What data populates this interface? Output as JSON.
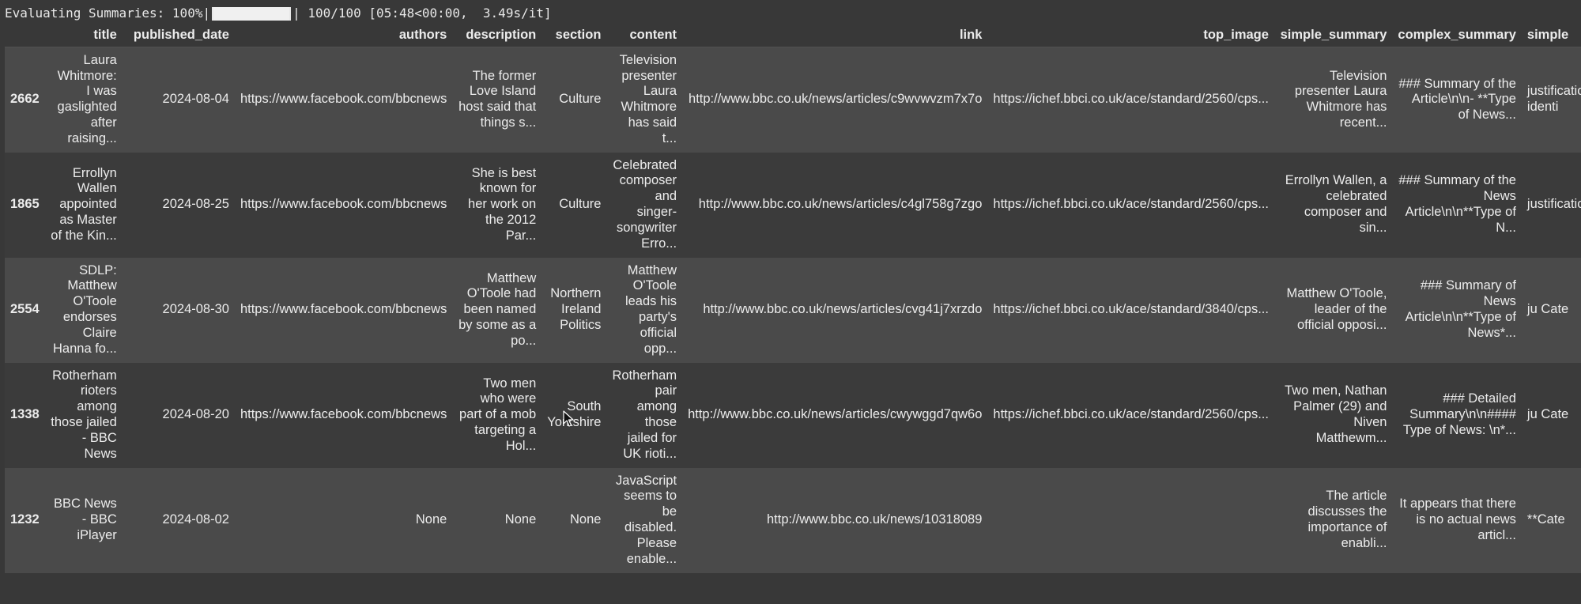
{
  "progress": {
    "label": "Evaluating Summaries: 100%|",
    "status": "| 100/100 [05:48<00:00,  3.49s/it]",
    "fraction": 1.0
  },
  "columns": [
    "",
    "title",
    "published_date",
    "authors",
    "description",
    "section",
    "content",
    "link",
    "top_image",
    "simple_summary",
    "complex_summary",
    "simple"
  ],
  "rows": [
    {
      "index": "2662",
      "title": "Laura Whitmore: I was gaslighted after raising...",
      "published_date": "2024-08-04",
      "authors": "https://www.facebook.com/bbcnews",
      "description": "The former Love Island host said that things s...",
      "section": "Culture",
      "content": "Television presenter Laura Whitmore has said t...",
      "link": "http://www.bbc.co.uk/news/articles/c9wvwvzm7x7o",
      "top_image": "https://ichef.bbci.co.uk/ace/standard/2560/cps...",
      "simple_summary": "Television presenter Laura Whitmore has recent...",
      "complex_summary": "### Summary of the Article\\n\\n- **Type of News...",
      "simple_trunc": "justification=... identi"
    },
    {
      "index": "1865",
      "title": "Errollyn Wallen appointed as Master of the Kin...",
      "published_date": "2024-08-25",
      "authors": "https://www.facebook.com/bbcnews",
      "description": "She is best known for her work on the 2012 Par...",
      "section": "Culture",
      "content": "Celebrated composer and singer-songwriter Erro...",
      "link": "http://www.bbc.co.uk/news/articles/c4gl758g7zgo",
      "top_image": "https://ichef.bbci.co.uk/ace/standard/2560/cps...",
      "simple_summary": "Errollyn Wallen, a celebrated composer and sin...",
      "complex_summary": "### Summary of the News Article\\n\\n**Type of N...",
      "simple_trunc": "justification=\"** ar"
    },
    {
      "index": "2554",
      "title": "SDLP: Matthew O'Toole endorses Claire Hanna fo...",
      "published_date": "2024-08-30",
      "authors": "https://www.facebook.com/bbcnews",
      "description": "Matthew O'Toole had been named by some as a po...",
      "section": "Northern Ireland Politics",
      "content": "Matthew O'Toole leads his party's official opp...",
      "link": "http://www.bbc.co.uk/news/articles/cvg41j7xrzdo",
      "top_image": "https://ichef.bbci.co.uk/ace/standard/3840/cps...",
      "simple_summary": "Matthew O'Toole, leader of the official opposi...",
      "complex_summary": "### Summary of News Article\\n\\n**Type of News*...",
      "simple_trunc": "ju Cate"
    },
    {
      "index": "1338",
      "title": "Rotherham rioters among those jailed - BBC News",
      "published_date": "2024-08-20",
      "authors": "https://www.facebook.com/bbcnews",
      "description": "Two men who were part of a mob targeting a Hol...",
      "section": "South Yorkshire",
      "content": "Rotherham pair among those jailed for UK rioti...",
      "link": "http://www.bbc.co.uk/news/articles/cwywggd7qw6o",
      "top_image": "https://ichef.bbci.co.uk/ace/standard/2560/cps...",
      "simple_summary": "Two men, Nathan Palmer (29) and Niven Matthewm...",
      "complex_summary": "### Detailed Summary\\n\\n#### Type of News: \\n*...",
      "simple_trunc": "ju Cate"
    },
    {
      "index": "1232",
      "title": "BBC News - BBC iPlayer",
      "published_date": "2024-08-02",
      "authors": "None",
      "description": "None",
      "section": "None",
      "content": "JavaScript seems to be disabled. Please enable...",
      "link": "http://www.bbc.co.uk/news/10318089",
      "top_image": "",
      "simple_summary": "The article discusses the importance of enabli...",
      "complex_summary": "It appears that there is no actual news articl...",
      "simple_trunc": "**Cate"
    }
  ]
}
